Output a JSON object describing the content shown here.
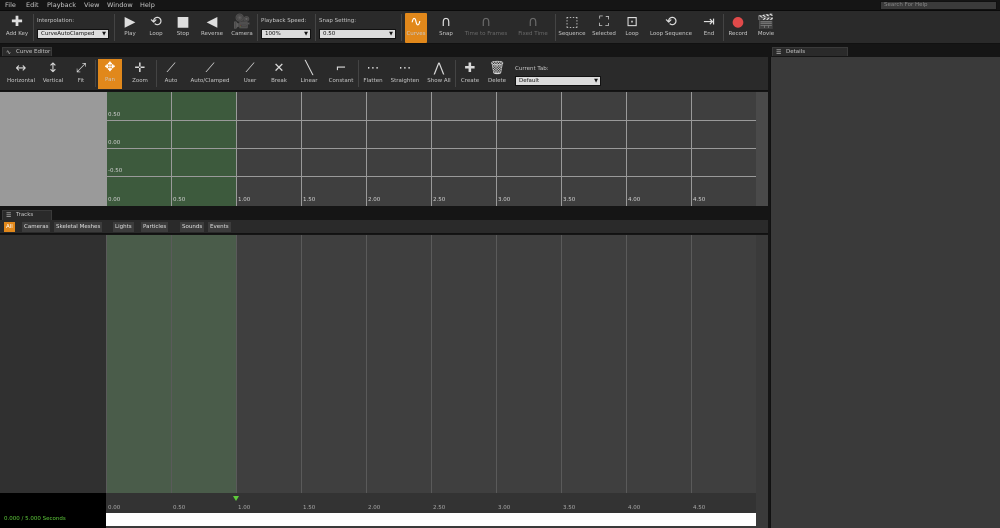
{
  "menu": [
    "File",
    "Edit",
    "Playback",
    "View",
    "Window",
    "Help"
  ],
  "search": {
    "placeholder": "Search For Help"
  },
  "toolbar": {
    "add_key": "Add Key",
    "interp_label": "Interpolation:",
    "interp_value": "CurveAutoClamped",
    "play": "Play",
    "loop": "Loop",
    "stop": "Stop",
    "reverse": "Reverse",
    "camera": "Camera",
    "speed_label": "Playback Speed:",
    "speed_value": "100%",
    "snap_label": "Snap Setting:",
    "snap_value": "0.50",
    "curves": "Curves",
    "snap": "Snap",
    "time_to_frames": "Time to Frames",
    "fixed_time": "Fixed Time",
    "sequence": "Sequence",
    "selected": "Selected",
    "loop2": "Loop",
    "loop_sequence": "Loop Sequence",
    "end": "End",
    "record": "Record",
    "movie": "Movie"
  },
  "tabs": {
    "curve_editor": "Curve Editor",
    "tracks": "Tracks",
    "details": "Details"
  },
  "curve_toolbar": {
    "horizontal": "Horizontal",
    "vertical": "Vertical",
    "fit": "Fit",
    "pan": "Pan",
    "zoom": "Zoom",
    "auto": "Auto",
    "auto_clamped": "Auto/Clamped",
    "user": "User",
    "break": "Break",
    "linear": "Linear",
    "constant": "Constant",
    "flatten": "Flatten",
    "straighten": "Straighten",
    "show_all": "Show All",
    "create": "Create",
    "delete": "Delete",
    "current_tab_label": "Current Tab:",
    "current_tab_value": "Default"
  },
  "curve_grid": {
    "y_labels": [
      "0.50",
      "0.00",
      "-0.50"
    ],
    "x_labels": [
      "0.00",
      "0.50",
      "1.00",
      "1.50",
      "2.00",
      "2.50",
      "3.00",
      "3.50",
      "4.00",
      "4.50"
    ]
  },
  "tracks": {
    "filters": [
      "All",
      "Cameras",
      "Skeletal Meshes",
      "Lights",
      "Particles",
      "Sounds",
      "Events"
    ],
    "x_labels": [
      "0.00",
      "0.50",
      "1.00",
      "1.50",
      "2.00",
      "2.50",
      "3.00",
      "3.50",
      "4.00",
      "4.50"
    ],
    "time_readout": "0.000 / 5.000 Seconds"
  },
  "colors": {
    "accent": "#e1881b",
    "green_region": "#3d5a3d",
    "playhead": "#5ecb3b"
  }
}
